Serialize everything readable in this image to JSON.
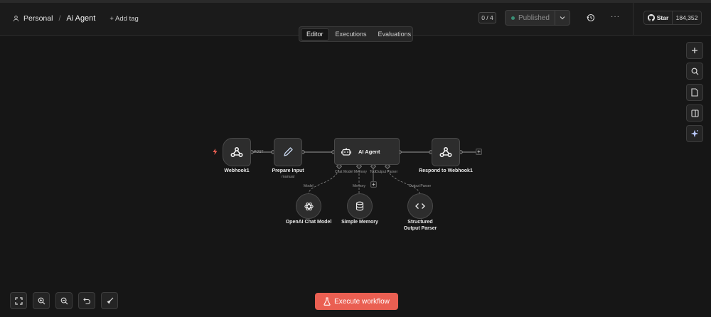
{
  "header": {
    "project": "Personal",
    "workflow_name": "Ai Agent",
    "add_tag_label": "+ Add tag",
    "counter": "0 / 4",
    "publish_status": "Published",
    "github": {
      "star_label": "Star",
      "star_count": "184,352"
    }
  },
  "view_tabs": [
    {
      "label": "Editor",
      "active": true
    },
    {
      "label": "Executions",
      "active": false
    },
    {
      "label": "Evaluations",
      "active": false
    }
  ],
  "nodes": {
    "webhook": {
      "label": "Webhook1",
      "port_label": "POST"
    },
    "prepare": {
      "label": "Prepare Input",
      "sublabel": "manual"
    },
    "agent": {
      "label": "AI Agent",
      "ports": {
        "chat_model": "Chat Model",
        "memory": "Memory",
        "tool": "Tool",
        "output_parser": "Output Parser"
      }
    },
    "respond": {
      "label": "Respond to Webhook1"
    },
    "openai": {
      "label": "OpenAI Chat Model",
      "edge_label": "Model"
    },
    "memory": {
      "label": "Simple Memory",
      "edge_label": "Memory"
    },
    "parser": {
      "label": "Structured Output Parser",
      "edge_label": "Output Parser"
    }
  },
  "actions": {
    "execute_label": "Execute workflow"
  },
  "colors": {
    "accent": "#ea5f52",
    "status": "#3a8f76",
    "canvas": "#161616"
  }
}
